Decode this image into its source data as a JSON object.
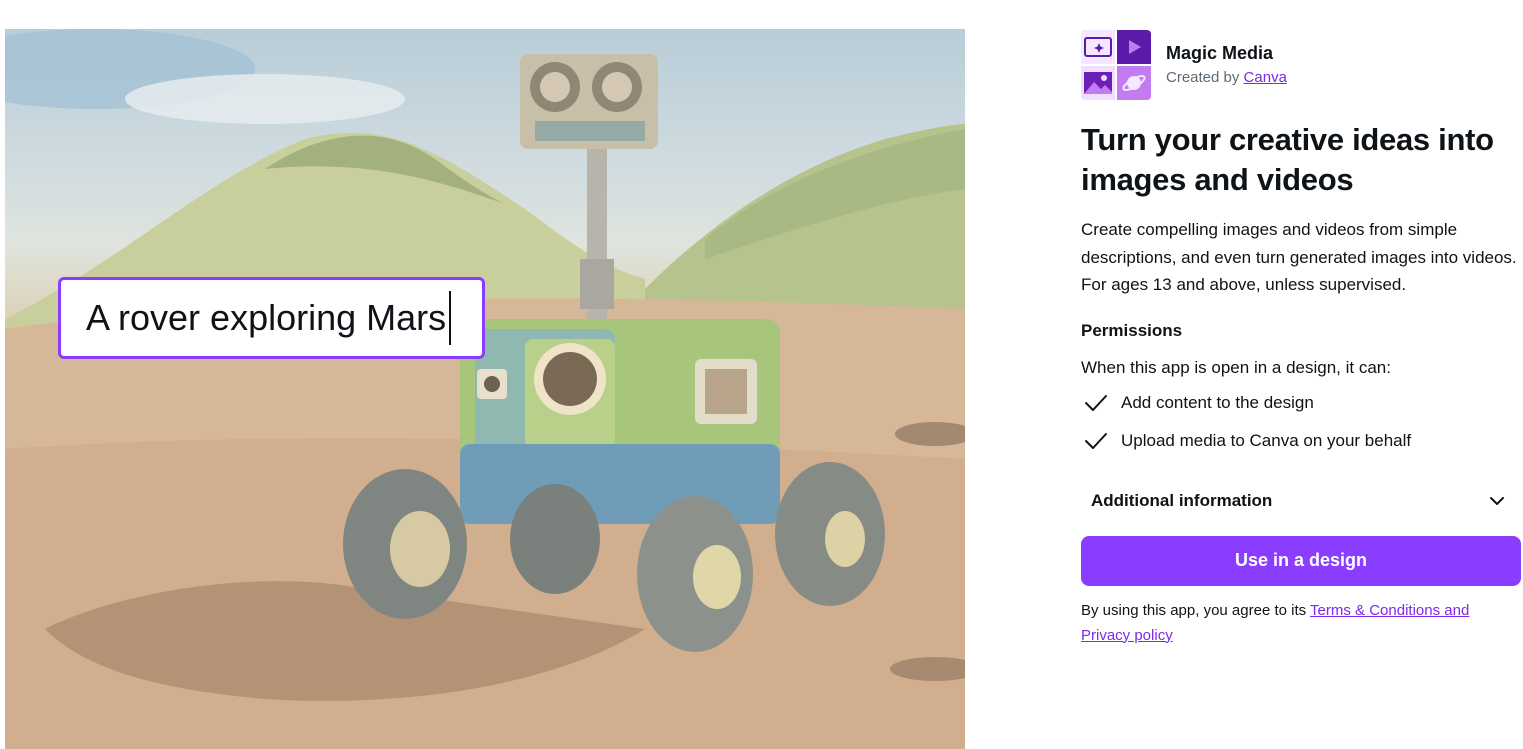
{
  "hero": {
    "prompt_text": "A rover exploring Mars"
  },
  "app": {
    "name": "Magic Media",
    "created_by_prefix": "Created by",
    "creator": "Canva"
  },
  "headline": "Turn your creative ideas into images and videos",
  "description": "Create compelling images and videos from simple descriptions, and even turn generated images into videos. For ages 13 and above, unless supervised.",
  "permissions": {
    "title": "Permissions",
    "intro": "When this app is open in a design, it can:",
    "items": [
      {
        "label": "Add content to the design",
        "icon": "checkmark-icon"
      },
      {
        "label": "Upload media to Canva on your behalf",
        "icon": "checkmark-icon"
      }
    ]
  },
  "additional_info": {
    "label": "Additional information",
    "icon": "chevron-down-icon"
  },
  "cta": {
    "label": "Use in a design"
  },
  "terms": {
    "prefix": "By using this app, you agree to its",
    "link": "Terms & Conditions and Privacy policy"
  },
  "colors": {
    "accent": "#8b3dff",
    "link": "#7d2ae8",
    "text": "#0e1318",
    "muted": "#5e6a76"
  }
}
